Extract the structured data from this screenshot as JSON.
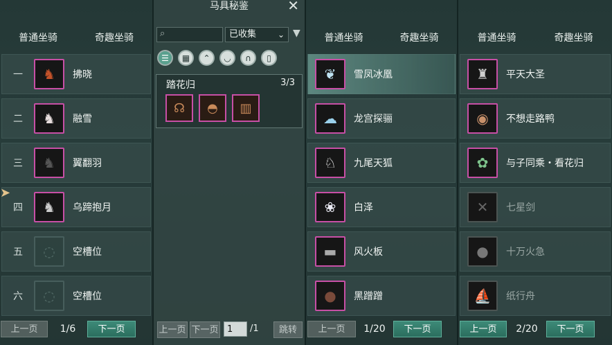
{
  "left_panel": {
    "tabs": [
      "普通坐骑",
      "奇趣坐骑"
    ],
    "rows": [
      {
        "num": "一",
        "name": "拂晓",
        "icon": "horse-red-icon",
        "glyph": "♞",
        "color": "#c4522a"
      },
      {
        "num": "二",
        "name": "融雪",
        "icon": "horse-white-icon",
        "glyph": "♞",
        "color": "#e8dede"
      },
      {
        "num": "三",
        "name": "翼翻羽",
        "icon": "horse-black-icon",
        "glyph": "♞",
        "color": "#555"
      },
      {
        "num": "四",
        "name": "乌蹄抱月",
        "icon": "horse-grey-icon",
        "glyph": "♞",
        "color": "#ccc"
      },
      {
        "num": "五",
        "name": "空槽位",
        "icon": "empty-slot-icon"
      },
      {
        "num": "六",
        "name": "空槽位",
        "icon": "empty-slot-icon"
      }
    ],
    "pager": {
      "prev": "上一页",
      "info": "1/6",
      "next": "下一页"
    }
  },
  "middle_panel": {
    "title": "马具秘鉴",
    "search_placeholder": "",
    "filter_value": "已收集",
    "categories": [
      "list-icon",
      "grid-icon",
      "head-icon",
      "saddle-icon",
      "stirrup-icon",
      "leg-icon"
    ],
    "set": {
      "name": "踏花归",
      "count": "3/3"
    },
    "pager": {
      "prev": "上一页",
      "next": "下一页",
      "page": "1",
      "total": "/1",
      "jump": "跳转"
    }
  },
  "right_panel_1": {
    "tabs": [
      "普通坐骑",
      "奇趣坐骑"
    ],
    "rows": [
      {
        "name": "雪凤冰凰",
        "icon": "ice-phoenix-icon",
        "glyph": "❦",
        "color": "#bfe3f2"
      },
      {
        "name": "龙宫探骊",
        "icon": "dragon-cloud-icon",
        "glyph": "☁",
        "color": "#9ad0ea"
      },
      {
        "name": "九尾天狐",
        "icon": "white-fox-icon",
        "glyph": "♘",
        "color": "#f3f3f3"
      },
      {
        "name": "白泽",
        "icon": "baize-beast-icon",
        "glyph": "❀",
        "color": "#ececf5"
      },
      {
        "name": "风火板",
        "icon": "skateboard-icon",
        "glyph": "▬",
        "color": "#aaa"
      },
      {
        "name": "黑蹭蹭",
        "icon": "black-pot-icon",
        "glyph": "●",
        "color": "#7a4a3a"
      }
    ],
    "pager": {
      "prev": "上一页",
      "info": "1/20",
      "next": "下一页"
    }
  },
  "right_panel_2": {
    "tabs": [
      "普通坐骑",
      "奇趣坐骑"
    ],
    "rows": [
      {
        "name": "平天大圣",
        "icon": "bull-demon-icon",
        "glyph": "♜",
        "color": "#cfcfcf"
      },
      {
        "name": "不想走路鸭",
        "icon": "basket-duck-icon",
        "glyph": "◉",
        "color": "#c8906a"
      },
      {
        "name": "与子同乘・看花归",
        "icon": "flower-couple-icon",
        "glyph": "✿",
        "color": "#7ec48c"
      },
      {
        "name": "七星剑",
        "icon": "sword-icon",
        "glyph": "✕",
        "color": "#666",
        "dim": true
      },
      {
        "name": "十万火急",
        "icon": "bomb-icon",
        "glyph": "●",
        "color": "#777",
        "dim": true
      },
      {
        "name": "纸行舟",
        "icon": "paper-boat-icon",
        "glyph": "⛵",
        "color": "#aaa",
        "dim": true
      }
    ],
    "pager": {
      "prev": "上一页",
      "info": "2/20",
      "next": "下一页"
    }
  }
}
